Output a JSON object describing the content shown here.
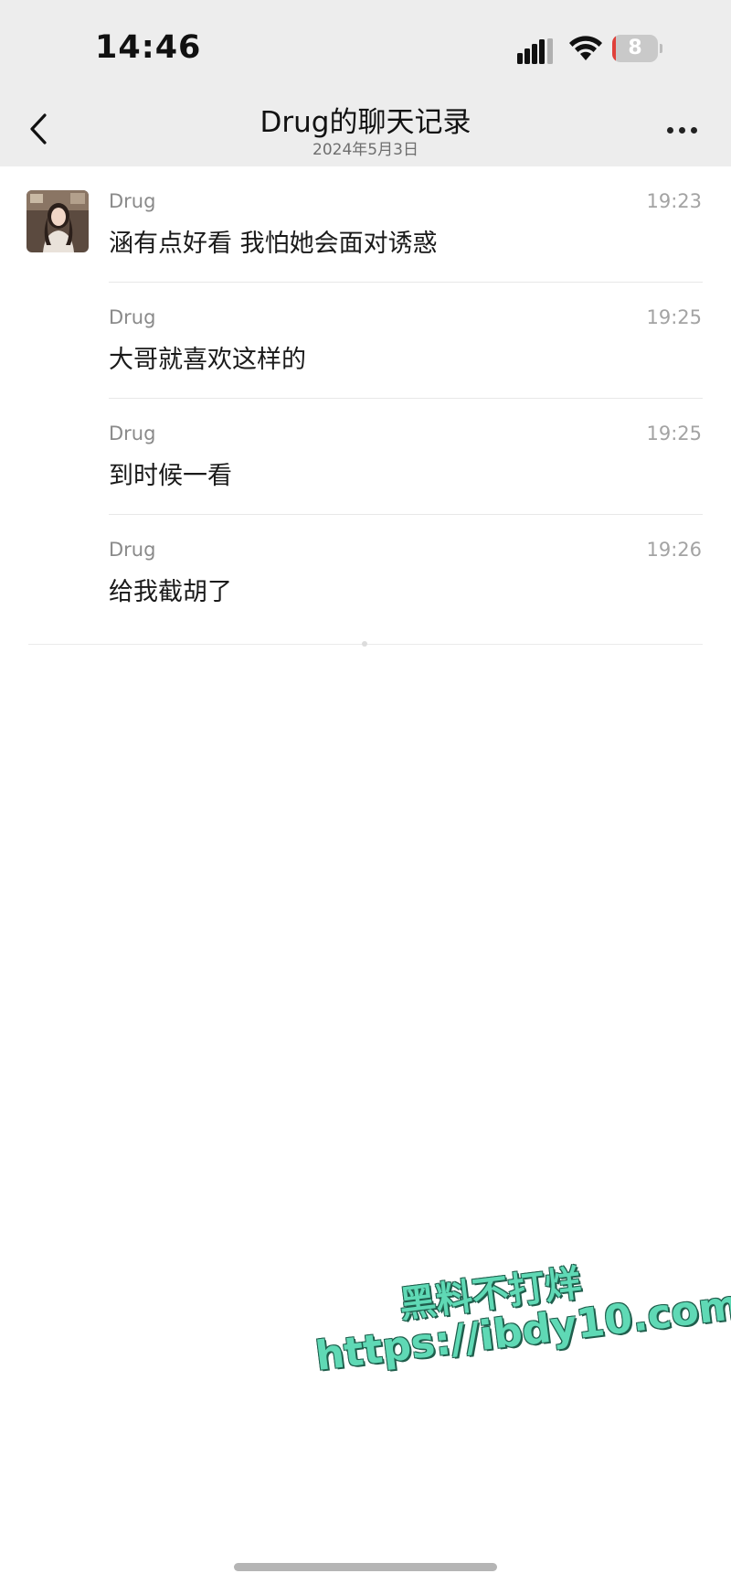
{
  "status_bar": {
    "time": "14:46",
    "battery_level": "8",
    "battery_fraction": 0.08,
    "icons": [
      "signal-icon",
      "wifi-icon",
      "battery-icon"
    ]
  },
  "nav": {
    "title": "Drug的聊天记录",
    "subtitle": "2024年5月3日",
    "back_icon": "chevron-left-icon",
    "more_icon": "more-icon"
  },
  "messages": [
    {
      "sender": "Drug",
      "time": "19:23",
      "text": "涵有点好看 我怕她会面对诱惑",
      "show_avatar": true
    },
    {
      "sender": "Drug",
      "time": "19:25",
      "text": "大哥就喜欢这样的",
      "show_avatar": false
    },
    {
      "sender": "Drug",
      "time": "19:25",
      "text": "到时候一看",
      "show_avatar": false
    },
    {
      "sender": "Drug",
      "time": "19:26",
      "text": "给我截胡了",
      "show_avatar": false
    }
  ],
  "watermark": {
    "line1": "黑料不打烊",
    "line2": "https://ibdy10.com"
  },
  "colors": {
    "header_bg": "#ededed",
    "watermark": "#5fd9b5",
    "battery_low": "#e0403a"
  }
}
